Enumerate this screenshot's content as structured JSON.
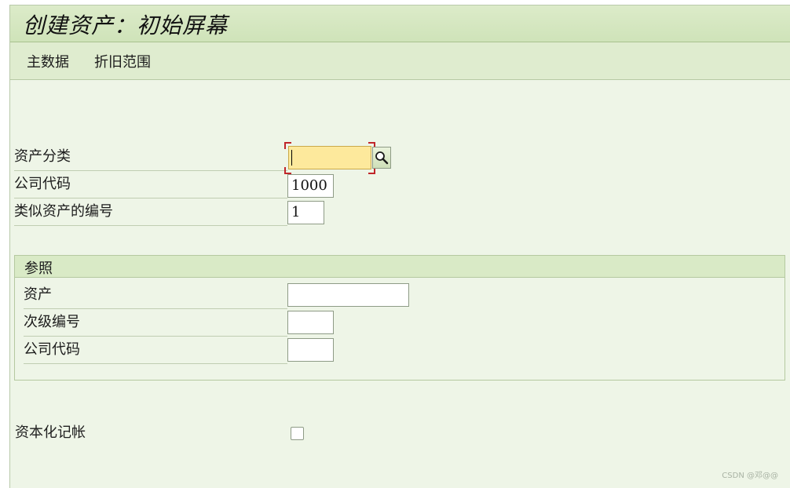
{
  "header": {
    "title": "创建资产：初始屏幕"
  },
  "toolbar": {
    "items": [
      {
        "label": "主数据"
      },
      {
        "label": "折旧范围"
      }
    ]
  },
  "fields": {
    "asset_class": {
      "label": "资产分类",
      "value": ""
    },
    "company_code": {
      "label": "公司代码",
      "value": "1000"
    },
    "similar_count": {
      "label": "类似资产的编号",
      "value": "1"
    }
  },
  "reference": {
    "title": "参照",
    "asset": {
      "label": "资产",
      "value": ""
    },
    "sub_number": {
      "label": "次级编号",
      "value": ""
    },
    "company_code": {
      "label": "公司代码",
      "value": ""
    }
  },
  "capitalize": {
    "label": "资本化记帐",
    "checked": false
  },
  "icons": {
    "search_help": "magnifier-icon"
  },
  "colors": {
    "background": "#eef5e7",
    "title_bar": "#cfe3b9",
    "required_field": "#fde99c",
    "focus_corner": "#c0262a"
  },
  "watermark": "CSDN @邓@@"
}
